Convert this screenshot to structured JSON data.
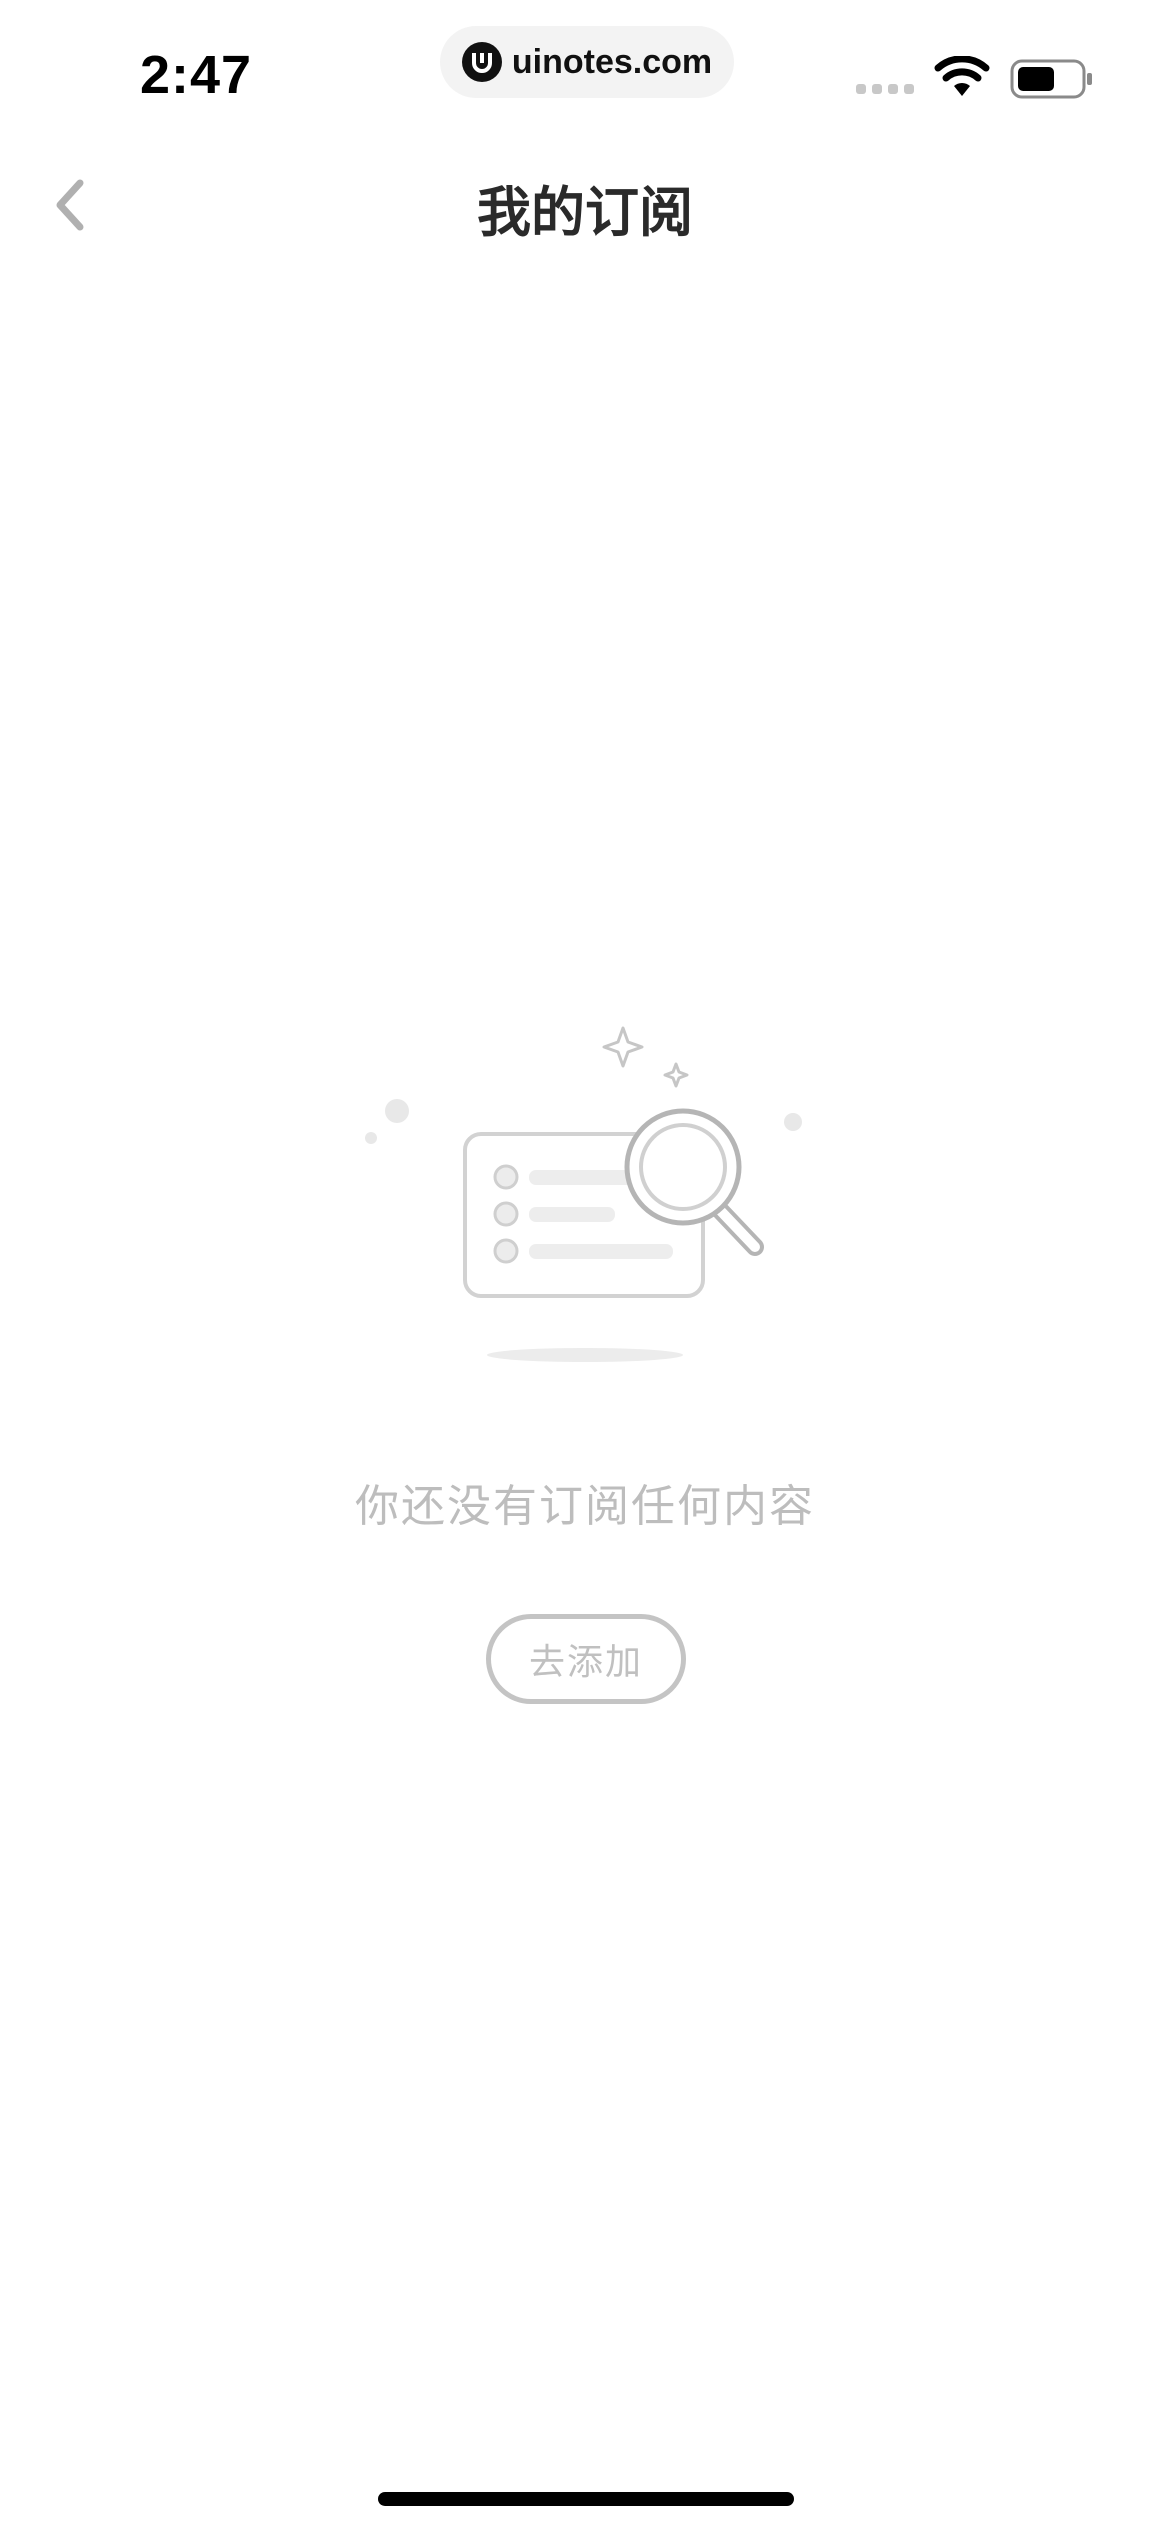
{
  "status_bar": {
    "time": "2:47",
    "url": "uinotes.com",
    "icons": [
      "cellular-signal-icon",
      "wifi-icon",
      "battery-icon"
    ]
  },
  "nav": {
    "back_icon": "chevron-left-icon",
    "title": "我的订阅"
  },
  "empty_state": {
    "illustration": "empty-list-magnifier-illustration",
    "message": "你还没有订阅任何内容",
    "button_label": "去添加"
  },
  "colors": {
    "title": "#2a2a2a",
    "muted_text": "#bdbdbd",
    "button_border": "#c4c4c4",
    "back_icon": "#b0b0b0"
  }
}
